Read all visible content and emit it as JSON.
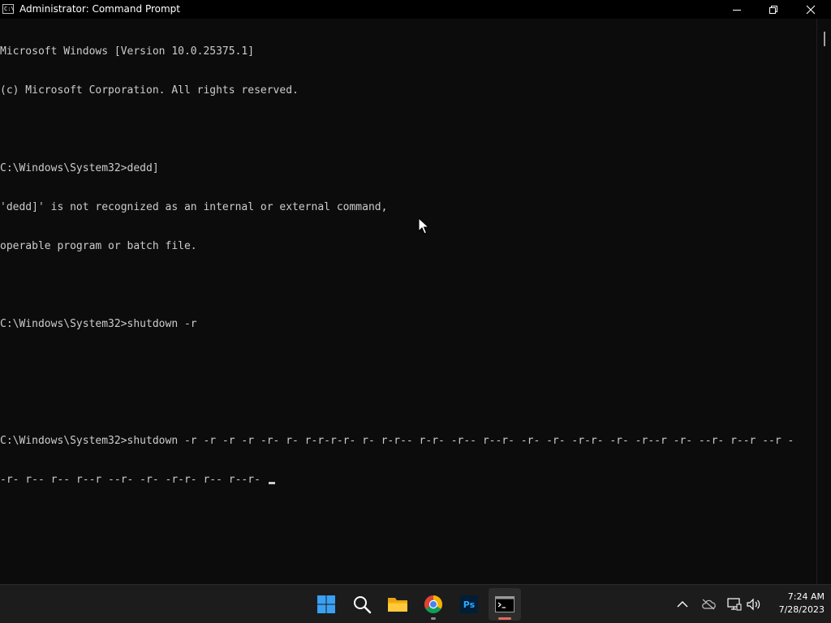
{
  "window": {
    "title": "Administrator: Command Prompt",
    "icon_label": "C:\\"
  },
  "console": {
    "lines": [
      "Microsoft Windows [Version 10.0.25375.1]",
      "(c) Microsoft Corporation. All rights reserved.",
      "",
      "C:\\Windows\\System32>dedd]",
      "'dedd]' is not recognized as an internal or external command,",
      "operable program or batch file.",
      "",
      "C:\\Windows\\System32>shutdown -r",
      "",
      "",
      "C:\\Windows\\System32>shutdown -r -r -r -r -r- r- r-r-r-r- r- r-r-- r-r- -r-- r--r- -r- -r- -r-r- -r- -r--r -r- --r- r--r --r -",
      "-r- r-- r-- r--r --r- -r- -r-r- r-- r--r- "
    ],
    "text_color": "#cccccc",
    "background": "#0c0c0c"
  },
  "taskbar": {
    "items": [
      {
        "name": "start",
        "icon": "windows-logo-icon"
      },
      {
        "name": "search",
        "icon": "search-icon"
      },
      {
        "name": "file-explorer",
        "icon": "folder-icon"
      },
      {
        "name": "chrome",
        "icon": "chrome-icon"
      },
      {
        "name": "photoshop",
        "icon": "photoshop-icon",
        "label": "Ps"
      },
      {
        "name": "command-prompt",
        "icon": "terminal-icon",
        "active": true
      }
    ],
    "tray": {
      "icons": [
        "chevron-up-icon",
        "cloud-offline-icon",
        "network-icon",
        "volume-icon"
      ]
    },
    "clock": {
      "time": "7:24 AM",
      "date": "7/28/2023"
    }
  },
  "colors": {
    "accent": "#0078d4",
    "active_indicator": "#e06c5a",
    "taskbar_bg": "#1c1c1c"
  }
}
